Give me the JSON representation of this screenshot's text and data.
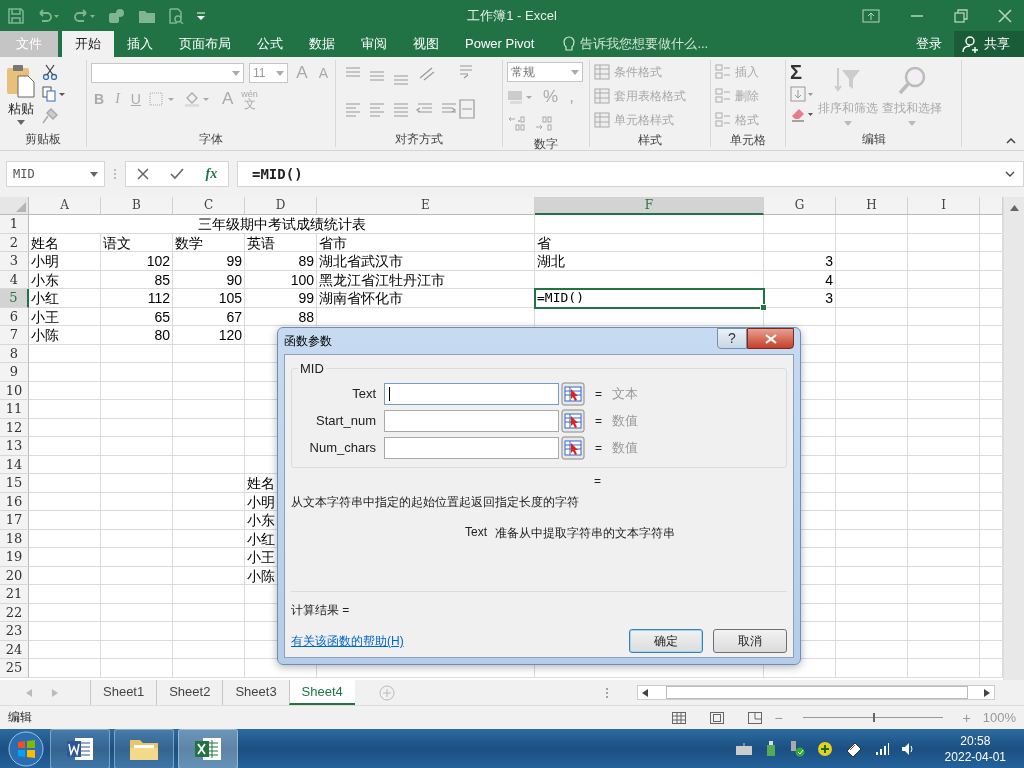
{
  "window": {
    "title": "工作簿1 - Excel"
  },
  "file_menu": {
    "label": "文件"
  },
  "ribbon_tabs": [
    {
      "label": "开始",
      "selected": true
    },
    {
      "label": "插入",
      "selected": false
    },
    {
      "label": "页面布局",
      "selected": false
    },
    {
      "label": "公式",
      "selected": false
    },
    {
      "label": "数据",
      "selected": false
    },
    {
      "label": "审阅",
      "selected": false
    },
    {
      "label": "视图",
      "selected": false
    },
    {
      "label": "Power Pivot",
      "selected": false
    }
  ],
  "tell_me": {
    "placeholder": "告诉我您想要做什么..."
  },
  "account": {
    "sign_in": "登录",
    "share": "共享"
  },
  "ribbon": {
    "clipboard": {
      "label": "剪贴板",
      "paste": "粘贴"
    },
    "font": {
      "label": "字体",
      "size": "11",
      "grow": "A",
      "shrink": "A",
      "bold": "B",
      "italic": "I",
      "underline": "U",
      "font_color": "A",
      "phonetic_top": "wén",
      "phonetic_bottom": "文"
    },
    "alignment": {
      "label": "对齐方式"
    },
    "number": {
      "label": "数字",
      "format": "常规",
      "percent": "%",
      "comma": ","
    },
    "styles": {
      "label": "样式",
      "commands": [
        {
          "label": "条件格式",
          "disabled": true
        },
        {
          "label": "套用表格格式",
          "disabled": true
        },
        {
          "label": "单元格样式",
          "disabled": true
        }
      ]
    },
    "cells": {
      "label": "单元格",
      "commands": [
        {
          "label": "插入",
          "disabled": true
        },
        {
          "label": "删除",
          "disabled": true
        },
        {
          "label": "格式",
          "disabled": true
        }
      ]
    },
    "editing": {
      "label": "编辑",
      "autosum": "Σ",
      "commands": [
        {
          "label": "排序和筛选",
          "disabled": true
        },
        {
          "label": "查找和选择",
          "disabled": true
        }
      ]
    }
  },
  "formula_bar": {
    "name_box": "MID",
    "function_label": "fx",
    "formula": "=MID()"
  },
  "grid": {
    "columns": [
      {
        "label": "A",
        "selected": false
      },
      {
        "label": "B",
        "selected": false
      },
      {
        "label": "C",
        "selected": false
      },
      {
        "label": "D",
        "selected": false
      },
      {
        "label": "E",
        "selected": false
      },
      {
        "label": "F",
        "selected": true
      },
      {
        "label": "G",
        "selected": false
      },
      {
        "label": "H",
        "selected": false
      },
      {
        "label": "I",
        "selected": false
      }
    ],
    "rows": [
      {
        "number": "1",
        "selected": false,
        "title": "三年级期中考试成绩统计表"
      },
      {
        "number": "2",
        "selected": false,
        "cells": [
          {
            "kind": "text",
            "text": "姓名"
          },
          {
            "kind": "text",
            "text": "语文"
          },
          {
            "kind": "text",
            "text": "数学"
          },
          {
            "kind": "text",
            "text": "英语"
          },
          {
            "kind": "text",
            "text": "省市"
          },
          {
            "kind": "text",
            "text": "省"
          }
        ]
      },
      {
        "number": "3",
        "selected": false,
        "cells": [
          {
            "kind": "text",
            "text": "小明"
          },
          {
            "kind": "number",
            "text": "102"
          },
          {
            "kind": "number",
            "text": "99"
          },
          {
            "kind": "number",
            "text": "89"
          },
          {
            "kind": "text",
            "text": "湖北省武汉市"
          },
          {
            "kind": "text",
            "text": "湖北"
          },
          {
            "kind": "number",
            "text": "3"
          }
        ]
      },
      {
        "number": "4",
        "selected": false,
        "cells": [
          {
            "kind": "text",
            "text": "小东"
          },
          {
            "kind": "number",
            "text": "85"
          },
          {
            "kind": "number",
            "text": "90"
          },
          {
            "kind": "number",
            "text": "100"
          },
          {
            "kind": "text",
            "text": "黑龙江省江牡丹江市"
          },
          {
            "kind": "blank"
          },
          {
            "kind": "number",
            "text": "4"
          }
        ]
      },
      {
        "number": "5",
        "selected": true,
        "cells": [
          {
            "kind": "text",
            "text": "小红"
          },
          {
            "kind": "number",
            "text": "112"
          },
          {
            "kind": "number",
            "text": "105"
          },
          {
            "kind": "number",
            "text": "99"
          },
          {
            "kind": "text",
            "text": "湖南省怀化市"
          },
          {
            "kind": "formula",
            "text": "=MID()"
          },
          {
            "kind": "number",
            "text": "3"
          }
        ]
      },
      {
        "number": "6",
        "selected": false,
        "cells": [
          {
            "kind": "text",
            "text": "小王"
          },
          {
            "kind": "number",
            "text": "65"
          },
          {
            "kind": "number",
            "text": "67"
          },
          {
            "kind": "number",
            "text": "88"
          }
        ]
      },
      {
        "number": "7",
        "selected": false,
        "cells": [
          {
            "kind": "text",
            "text": "小陈"
          },
          {
            "kind": "number",
            "text": "80"
          },
          {
            "kind": "number",
            "text": "120"
          }
        ]
      },
      {
        "number": "8",
        "selected": false
      },
      {
        "number": "9",
        "selected": false
      },
      {
        "number": "10",
        "selected": false
      },
      {
        "number": "11",
        "selected": false
      },
      {
        "number": "12",
        "selected": false
      },
      {
        "number": "13",
        "selected": false
      },
      {
        "number": "14",
        "selected": false
      },
      {
        "number": "15",
        "selected": false,
        "cells": [
          {
            "kind": "blank"
          },
          {
            "kind": "blank"
          },
          {
            "kind": "blank"
          },
          {
            "kind": "text",
            "text": "姓名"
          }
        ]
      },
      {
        "number": "16",
        "selected": false,
        "cells": [
          {
            "kind": "blank"
          },
          {
            "kind": "blank"
          },
          {
            "kind": "blank"
          },
          {
            "kind": "text",
            "text": "小明"
          }
        ]
      },
      {
        "number": "17",
        "selected": false,
        "cells": [
          {
            "kind": "blank"
          },
          {
            "kind": "blank"
          },
          {
            "kind": "blank"
          },
          {
            "kind": "text",
            "text": "小东"
          }
        ]
      },
      {
        "number": "18",
        "selected": false,
        "cells": [
          {
            "kind": "blank"
          },
          {
            "kind": "blank"
          },
          {
            "kind": "blank"
          },
          {
            "kind": "text",
            "text": "小红"
          }
        ]
      },
      {
        "number": "19",
        "selected": false,
        "cells": [
          {
            "kind": "blank"
          },
          {
            "kind": "blank"
          },
          {
            "kind": "blank"
          },
          {
            "kind": "text",
            "text": "小王"
          }
        ]
      },
      {
        "number": "20",
        "selected": false,
        "cells": [
          {
            "kind": "blank"
          },
          {
            "kind": "blank"
          },
          {
            "kind": "blank"
          },
          {
            "kind": "text",
            "text": "小陈"
          }
        ]
      },
      {
        "number": "21",
        "selected": false
      },
      {
        "number": "22",
        "selected": false
      },
      {
        "number": "23",
        "selected": false
      },
      {
        "number": "24",
        "selected": false
      },
      {
        "number": "25",
        "selected": false
      }
    ]
  },
  "sheet_tabs": [
    {
      "label": "Sheet1",
      "selected": false
    },
    {
      "label": "Sheet2",
      "selected": false
    },
    {
      "label": "Sheet3",
      "selected": false
    },
    {
      "label": "Sheet4",
      "selected": true
    }
  ],
  "status_bar": {
    "mode": "编辑",
    "zoom_out": "−",
    "zoom_in": "+",
    "zoom": "100%",
    "zoom_slider": {
      "level": 0.5
    }
  },
  "dialog": {
    "title": "函数参数",
    "help": "?",
    "function_name": "MID",
    "arguments": [
      {
        "label": "Text",
        "focused": true,
        "equals": "=",
        "hint": "文本"
      },
      {
        "label": "Start_num",
        "focused": false,
        "equals": "=",
        "hint": "数值"
      },
      {
        "label": "Num_chars",
        "focused": false,
        "equals": "=",
        "hint": "数值"
      }
    ],
    "result_equals": "=",
    "description": "从文本字符串中指定的起始位置起返回指定长度的字符",
    "argument_name": "Text",
    "argument_help": "准备从中提取字符串的文本字符串",
    "result_label": "计算结果 =",
    "help_link": "有关该函数的帮助(H)",
    "buttons": [
      {
        "label": "确定",
        "kind": "default"
      },
      {
        "label": "取消",
        "kind": "normal"
      }
    ]
  },
  "taskbar": {
    "time": "20:58",
    "date": "2022-04-01"
  }
}
